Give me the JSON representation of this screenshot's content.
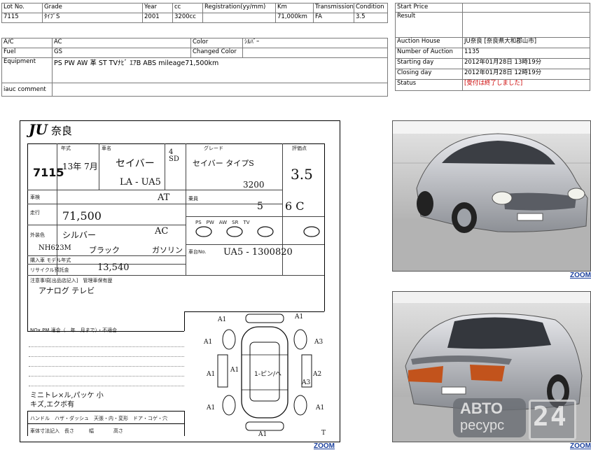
{
  "lot_table": {
    "headers": [
      "Lot No.",
      "Grade",
      "Year",
      "cc",
      "Registration(yy/mm)",
      "Km",
      "Transmission",
      "Condition"
    ],
    "values": [
      "7115",
      "ﾀｲﾌﾟS",
      "2001",
      "3200cc",
      "",
      "71,000km",
      "FA",
      "3.5"
    ]
  },
  "details": {
    "ac_label": "A/C",
    "ac_value": "AC",
    "color_label": "Color",
    "color_value": "ｼﾙﾊﾞｰ",
    "fuel_label": "Fuel",
    "fuel_value": "GS",
    "changed_color_label": "Changed Color",
    "changed_color_value": "",
    "equipment_label": "Equipment",
    "equipment_value": "PS PW AW 革 ST TVﾅﾋﾞ ｴｱB ABS  mileage71,500km",
    "comment_label": "iauc comment",
    "comment_value": ""
  },
  "auction": {
    "start_price_label": "Start Price",
    "start_price_value": "",
    "result_label": "Result",
    "result_value": "",
    "house_label": "Auction House",
    "house_value": "JU奈良 [奈良県大和郡山市]",
    "number_label": "Number of Auction",
    "number_value": "1135",
    "starting_label": "Starting day",
    "starting_value": "2012年01月28日 13時19分",
    "closing_label": "Closing day",
    "closing_value": "2012年01月28日 12時19分",
    "status_label": "Status",
    "status_value": "[受付は終了しました]"
  },
  "sheet": {
    "logo": "JU",
    "logo_city": "奈良",
    "lot": "7115",
    "year_hw": "13年 7月",
    "name_hw": "セイバー",
    "grade_hw": "セイバー タイプS",
    "doors_hw": "4 SD",
    "model_hw": "LA - UA5",
    "cc_hw": "3200",
    "score_hw": "3.5",
    "score2_hw": "6 C",
    "at_hw": "AT",
    "capacity_hw": "5",
    "km_hw": "71,500",
    "color_hw": "シルバー",
    "color_code_hw": "NH623M",
    "trim_hw": "ブラック",
    "aircon_hw": "AC",
    "fuel_hw": "ガソリン",
    "chassis_hw": "UA5 - 1300820",
    "recycle_hw": "13,540",
    "notes_hw": "アナログ テレビ",
    "inspector_hw": "ミニトレ×ル,パッケ 小キズ,エクボ有",
    "interior_hw": "1-ピン/ヘ",
    "zoom": "ZOOM"
  },
  "photos": {
    "zoom_front": "ZOOM",
    "zoom_rear": "ZOOM",
    "watermark_top": "АВТО",
    "watermark_bottom": "ресурс",
    "watermark_num": "24"
  }
}
